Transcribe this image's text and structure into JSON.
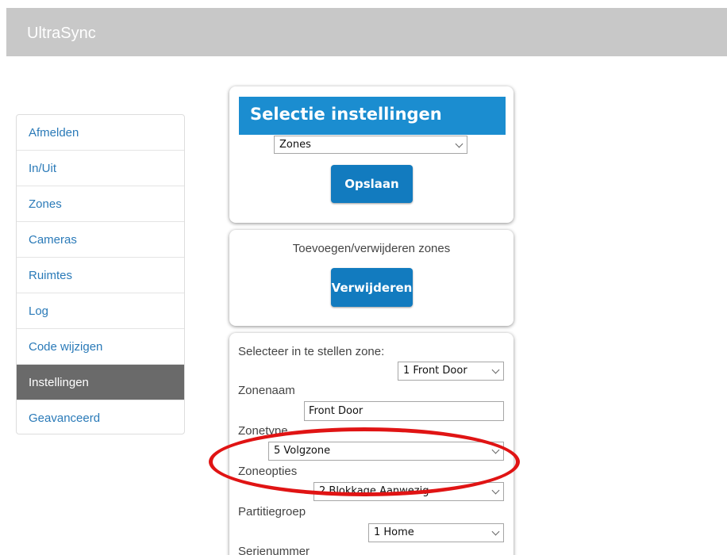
{
  "app": {
    "title": "UltraSync"
  },
  "sidebar": {
    "items": [
      {
        "label": "Afmelden"
      },
      {
        "label": "In/Uit"
      },
      {
        "label": "Zones"
      },
      {
        "label": "Cameras"
      },
      {
        "label": "Ruimtes"
      },
      {
        "label": "Log"
      },
      {
        "label": "Code wijzigen"
      },
      {
        "label": "Instellingen",
        "active": true
      },
      {
        "label": "Geavanceerd"
      }
    ]
  },
  "selection": {
    "header": "Selectie instellingen",
    "selected": "Zones",
    "save_label": "Opslaan"
  },
  "add_remove": {
    "title": "Toevoegen/verwijderen zones",
    "remove_label": "Verwijderen"
  },
  "zone_settings": {
    "select_zone_label": "Selecteer in te stellen zone:",
    "selected_zone": "1 Front Door",
    "name_label": "Zonenaam",
    "name_value": "Front Door",
    "type_label": "Zonetype",
    "type_value": "5 Volgzone",
    "options_label": "Zoneopties",
    "options_value": "2 Blokkage Aanwezig",
    "partition_label": "Partitiegroep",
    "partition_value": "1 Home",
    "serial_label": "Serienummer"
  },
  "colors": {
    "accent": "#1b8dd0",
    "button": "#127bbf",
    "link": "#2a7ab8",
    "active_nav": "#6a6a6a",
    "annotation": "#e01414"
  }
}
